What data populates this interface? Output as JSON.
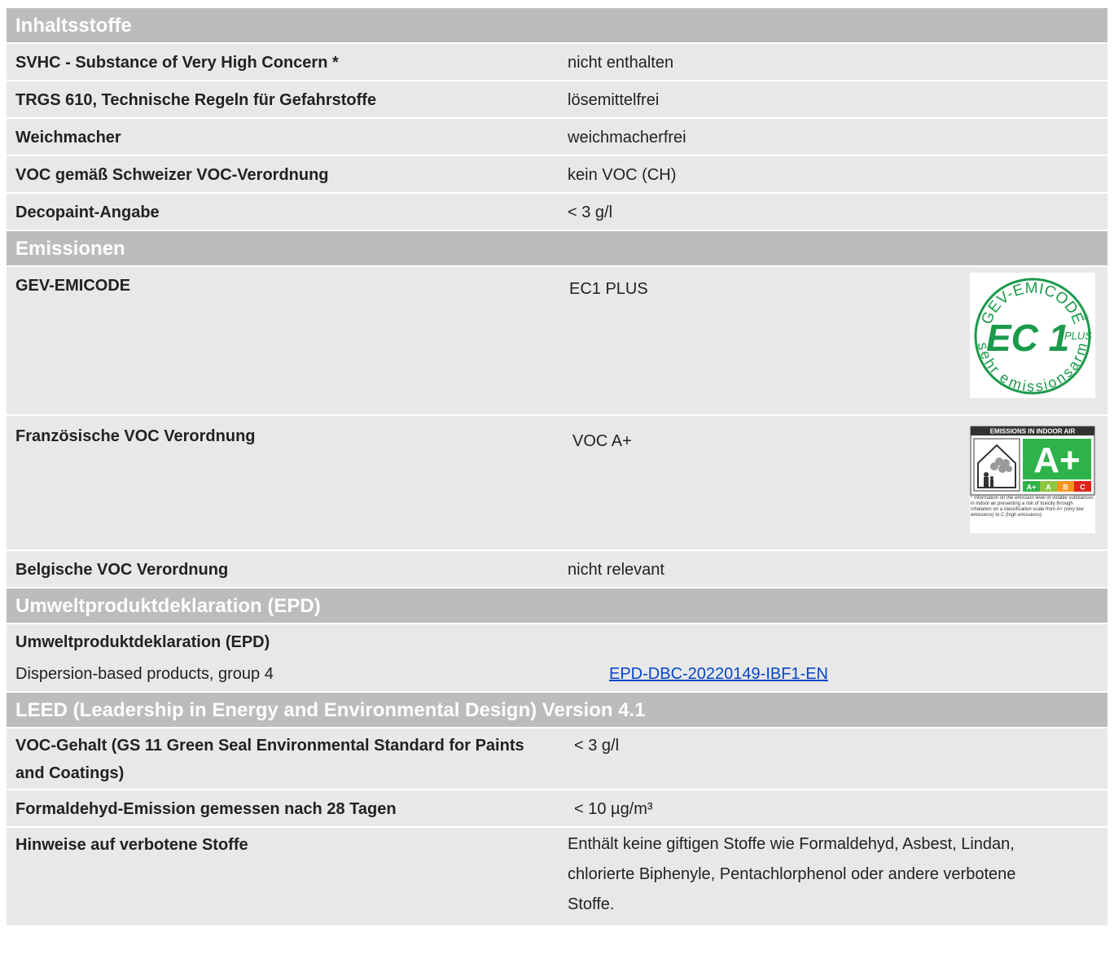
{
  "sections": [
    {
      "title": "Inhaltsstoffe",
      "rows": [
        {
          "label": "SVHC - Substance of Very High Concern *",
          "value": "nicht enthalten"
        },
        {
          "label": "TRGS 610, Technische Regeln für Gefahrstoffe",
          "value": "lösemittelfrei"
        },
        {
          "label": "Weichmacher",
          "value": "weichmacherfrei"
        },
        {
          "label": "VOC gemäß Schweizer VOC-Verordnung",
          "value": "kein VOC (CH)"
        },
        {
          "label": "Decopaint-Angabe",
          "value": "< 3 g/l"
        }
      ]
    },
    {
      "title": "Emissionen",
      "rows": [
        {
          "label": "GEV-EMICODE",
          "value": "EC1 PLUS"
        },
        {
          "label": "Französische VOC Verordnung",
          "value": "VOC A+"
        },
        {
          "label": "Belgische VOC Verordnung",
          "value": "nicht relevant"
        }
      ]
    },
    {
      "title": "Umweltproduktdeklaration (EPD)",
      "rows": [
        {
          "label": "Umweltproduktdeklaration (EPD)",
          "value": ""
        },
        {
          "label": "Dispersion-based products, group 4",
          "value": "EPD-DBC-20220149-IBF1-EN"
        }
      ]
    },
    {
      "title": "LEED (Leadership in Energy and Environmental Design) Version 4.1",
      "rows": [
        {
          "label": "VOC-Gehalt (GS 11 Green Seal Environmental Standard for Paints and Coatings)",
          "value": "< 3 g/l"
        },
        {
          "label": "Formaldehyd-Emission gemessen nach 28 Tagen",
          "value": "< 10 µg/m³"
        },
        {
          "label": "Hinweise auf verbotene Stoffe",
          "value": "Enthält keine giftigen Stoffe wie Formaldehyd, Asbest, Lindan, chlorierte Biphenyle, Pentachlorphenol oder andere verbotene Stoffe."
        }
      ]
    }
  ],
  "badges": {
    "emicode": {
      "top_text": "GEV-EMICODE",
      "main_text": "EC 1",
      "plus_text": "PLUS",
      "registered": "®",
      "bottom_text": "sehr emissionsarm",
      "color": "#1a9a4a"
    },
    "indoor_air": {
      "header": "EMISSIONS IN INDOOR AIR",
      "grade": "A+",
      "scale": [
        "A+",
        "A",
        "B",
        "C"
      ],
      "scale_colors": [
        "#2db34a",
        "#8dc63f",
        "#f7941d",
        "#e2231a"
      ],
      "footnote": "* Information on the emission level of volatile substances in indoor air presenting a risk of toxicity through inhalation on a classification scale from A+ (very low emissions) to C (high emissions)."
    }
  }
}
